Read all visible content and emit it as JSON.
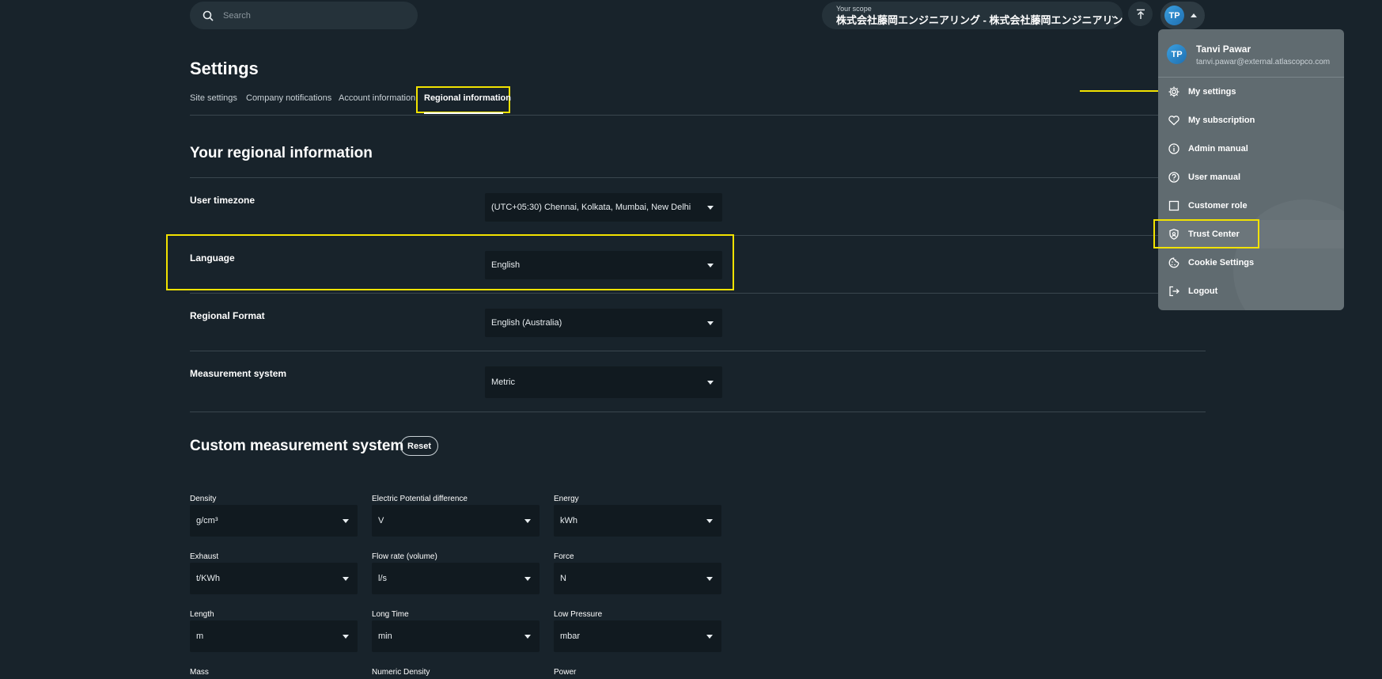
{
  "search": {
    "placeholder": "Search"
  },
  "scope": {
    "label": "Your scope",
    "value": "株式会社藤岡エンジニアリング - 株式会社藤岡エンジニアリング"
  },
  "user": {
    "initials": "TP",
    "name": "Tanvi Pawar",
    "email": "tanvi.pawar@external.atlascopco.com"
  },
  "page": {
    "title": "Settings",
    "tabs": [
      "Site settings",
      "Company notifications",
      "Account information",
      "Regional information"
    ]
  },
  "regional": {
    "title": "Your regional information",
    "rows": [
      {
        "label": "User timezone",
        "value": "(UTC+05:30) Chennai, Kolkata, Mumbai, New Delhi"
      },
      {
        "label": "Language",
        "value": "English"
      },
      {
        "label": "Regional Format",
        "value": "English (Australia)"
      },
      {
        "label": "Measurement system",
        "value": "Metric"
      }
    ]
  },
  "custom": {
    "title": "Custom measurement system",
    "reset_label": "Reset",
    "fields": [
      {
        "label": "Density",
        "value": "g/cm³"
      },
      {
        "label": "Electric Potential difference",
        "value": "V"
      },
      {
        "label": "Energy",
        "value": "kWh"
      },
      {
        "label": "Exhaust",
        "value": "t/KWh"
      },
      {
        "label": "Flow rate (volume)",
        "value": "l/s"
      },
      {
        "label": "Force",
        "value": "N"
      },
      {
        "label": "Length",
        "value": "m"
      },
      {
        "label": "Long Time",
        "value": "min"
      },
      {
        "label": "Low Pressure",
        "value": "mbar"
      },
      {
        "label": "Mass",
        "value": ""
      },
      {
        "label": "Numeric Density",
        "value": ""
      },
      {
        "label": "Power",
        "value": ""
      }
    ]
  },
  "menu": {
    "items": [
      {
        "label": "My settings",
        "icon": "gear-icon"
      },
      {
        "label": "My subscription",
        "icon": "heart-icon"
      },
      {
        "label": "Admin manual",
        "icon": "info-icon"
      },
      {
        "label": "User manual",
        "icon": "help-icon"
      },
      {
        "label": "Customer role",
        "icon": "square-icon"
      },
      {
        "label": "Trust Center",
        "icon": "shield-icon"
      },
      {
        "label": "Cookie Settings",
        "icon": "cookie-icon"
      },
      {
        "label": "Logout",
        "icon": "logout-icon"
      }
    ]
  },
  "colors": {
    "background": "#18232b",
    "highlight": "#f2e200",
    "menu": "#606b70",
    "avatar": "#2f8bd0"
  }
}
